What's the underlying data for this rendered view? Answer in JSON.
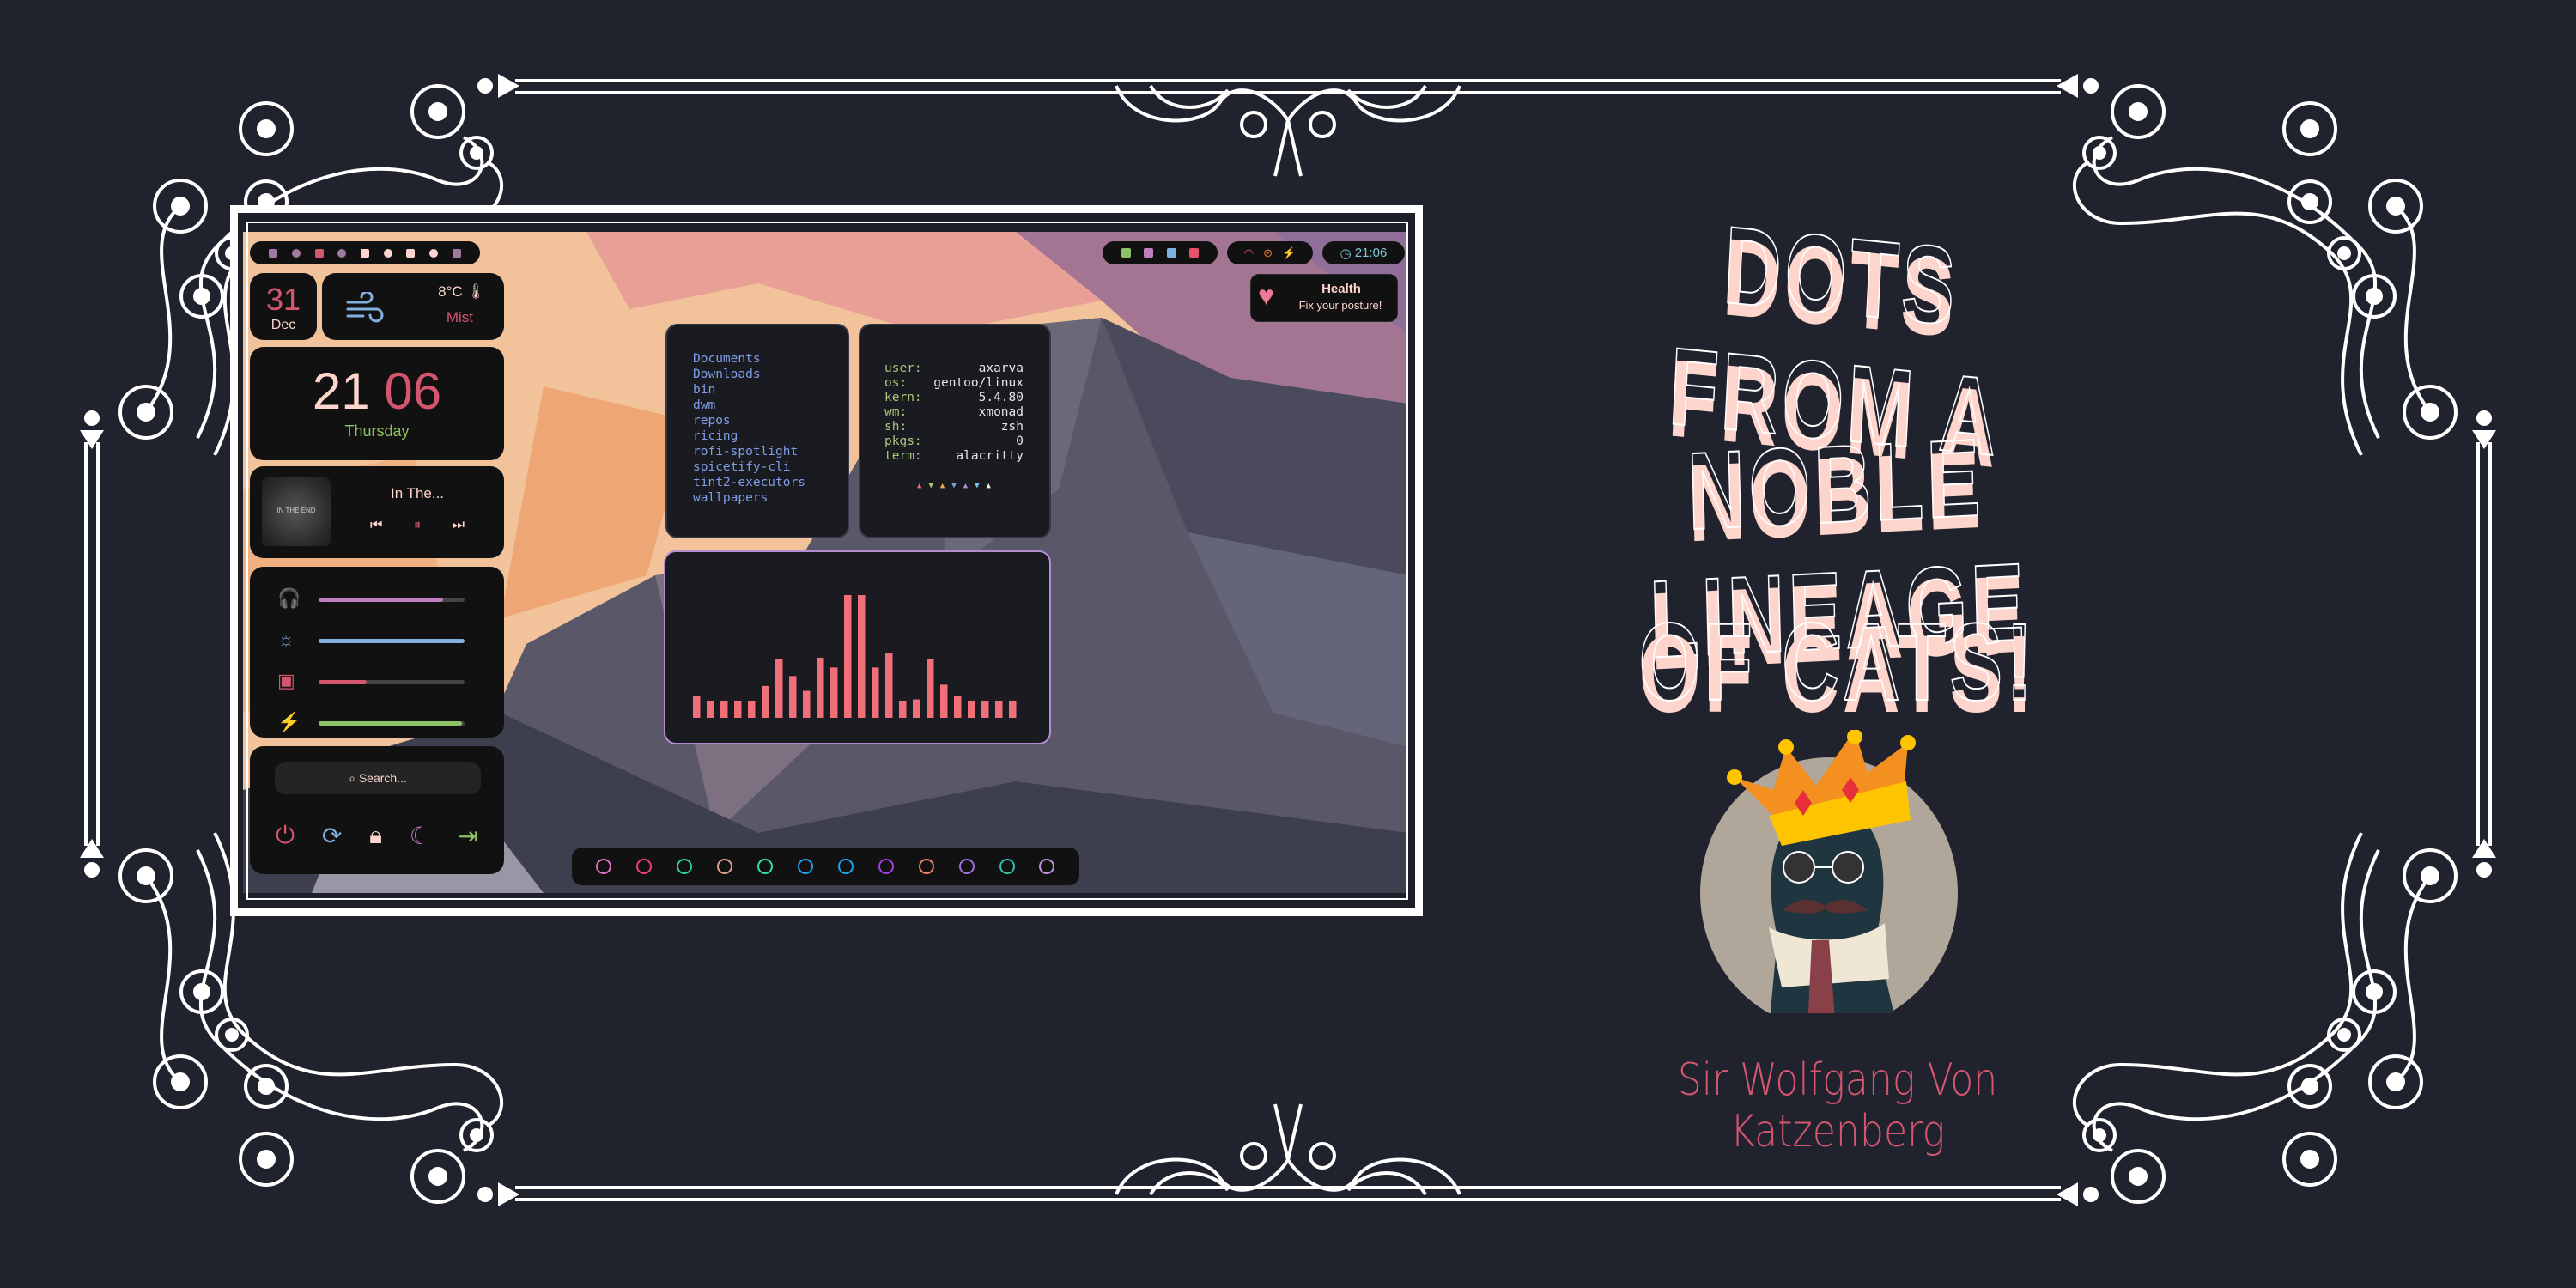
{
  "title_lines": [
    "DOTS FROM A",
    "NOBLE LINEAGE",
    "OF CATS!"
  ],
  "cat_name": "Sir Wolfgang Von Katzenberg",
  "colors": {
    "background": "#20222d",
    "title": "#fdd5cc",
    "name": "#d4566f",
    "widget_bg": "#111111",
    "accent_red": "#d4566f",
    "accent_green": "#8cc265",
    "accent_blue": "#7fb0e0",
    "accent_purple": "#c07ec0",
    "visualizer_bar": "#ef7078",
    "visualizer_border": "#b48ed0"
  },
  "desktop": {
    "left_bar_icons": [
      "terminal-icon",
      "firefox-icon",
      "folder-icon",
      "gamepad-icon",
      "chat-icon",
      "grid-icon",
      "ghost-icon",
      "circle-icon",
      "spotify-icon"
    ],
    "date": {
      "day": "31",
      "month": "Dec"
    },
    "weather": {
      "icon": "wind-icon",
      "temp": "8°C",
      "condition": "Mist"
    },
    "clock": {
      "hour": "21",
      "minute": "06",
      "weekday": "Thursday"
    },
    "music": {
      "title": "In The...",
      "album_art_text": "IN THE END"
    },
    "sliders": [
      {
        "icon": "headphones-icon",
        "value": 0.85,
        "color": "#c07ec0"
      },
      {
        "icon": "brightness-icon",
        "value": 1.0,
        "color": "#7fb0e0"
      },
      {
        "icon": "cpu-icon",
        "value": 0.33,
        "color": "#d4566f"
      },
      {
        "icon": "plug-icon",
        "value": 0.98,
        "color": "#8cc265"
      }
    ],
    "search": {
      "placeholder": "Search..."
    },
    "power_buttons": [
      "power-icon",
      "restart-icon",
      "lock-icon",
      "sleep-icon",
      "logout-icon"
    ],
    "files": [
      "Documents",
      "Downloads",
      "bin",
      "dwm",
      "repos",
      "ricing",
      "rofi-spotlight",
      "spicetify-cli",
      "tint2-executors",
      "wallpapers"
    ],
    "fetch": [
      {
        "k": "user:",
        "v": "axarva"
      },
      {
        "k": "os:",
        "v": "gentoo/linux"
      },
      {
        "k": "kern:",
        "v": "5.4.80"
      },
      {
        "k": "wm:",
        "v": "xmonad"
      },
      {
        "k": "sh:",
        "v": "zsh"
      },
      {
        "k": "pkgs:",
        "v": "0"
      },
      {
        "k": "term:",
        "v": "alacritty"
      }
    ],
    "fetch_colors": [
      "#ef6b78",
      "#a8c878",
      "#f0b050",
      "#7f9ee6",
      "#b88ad8",
      "#6ec8e8",
      "#e8f0f0"
    ],
    "visualizer": {
      "bars": [
        0.18,
        0.14,
        0.14,
        0.14,
        0.14,
        0.26,
        0.48,
        0.34,
        0.22,
        0.49,
        0.41,
        1.0,
        1.0,
        0.41,
        0.53,
        0.14,
        0.15,
        0.48,
        0.27,
        0.18,
        0.14,
        0.14,
        0.14,
        0.14
      ]
    },
    "dock_icons": [
      {
        "name": "app-launcher-icon",
        "color": "#e070c0"
      },
      {
        "name": "firefox-icon",
        "color": "#f04070"
      },
      {
        "name": "spotify-icon",
        "color": "#30d090"
      },
      {
        "name": "editor-icon",
        "color": "#e0a090"
      },
      {
        "name": "vim-icon",
        "color": "#30e0a0"
      },
      {
        "name": "bug-icon",
        "color": "#20a0f0"
      },
      {
        "name": "discord-icon",
        "color": "#20a0f0"
      },
      {
        "name": "screenshot-icon",
        "color": "#a040e0"
      },
      {
        "name": "brush-icon",
        "color": "#f08070"
      },
      {
        "name": "typography-icon",
        "color": "#a070e0"
      },
      {
        "name": "book-icon",
        "color": "#30c0b0"
      },
      {
        "name": "settings-doc-icon",
        "color": "#c090e0"
      }
    ],
    "tray_icons": [
      {
        "name": "terminal-icon",
        "color": "#8cc265"
      },
      {
        "name": "reddit-icon",
        "color": "#c07ec0"
      },
      {
        "name": "github-icon",
        "color": "#7fb0e0"
      },
      {
        "name": "mail-icon",
        "color": "#e8506a"
      }
    ],
    "status_icons": [
      {
        "name": "wifi-icon",
        "color": "#e8506a"
      },
      {
        "name": "eye-off-icon",
        "color": "#f08030"
      },
      {
        "name": "plug-icon",
        "color": "#a8d0f0"
      }
    ],
    "bar_clock": "21:06",
    "notification": {
      "title": "Health",
      "body": "Fix your posture!"
    }
  }
}
